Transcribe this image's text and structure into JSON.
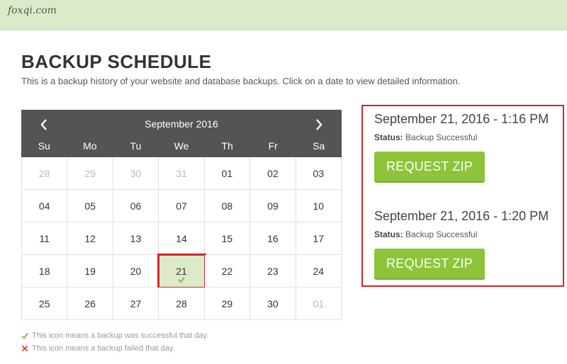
{
  "header": {
    "brand": "foxqi.com"
  },
  "page": {
    "title": "BACKUP SCHEDULE",
    "subtitle": "This is a backup history of your website and database backups. Click on a date to view detailed information."
  },
  "calendar": {
    "month_label": "September 2016",
    "weekdays": [
      "Su",
      "Mo",
      "Tu",
      "We",
      "Th",
      "Fr",
      "Sa"
    ],
    "weeks": [
      [
        {
          "d": "28",
          "muted": true
        },
        {
          "d": "29",
          "muted": true
        },
        {
          "d": "30",
          "muted": true
        },
        {
          "d": "31",
          "muted": true
        },
        {
          "d": "01"
        },
        {
          "d": "02"
        },
        {
          "d": "03"
        }
      ],
      [
        {
          "d": "04"
        },
        {
          "d": "05"
        },
        {
          "d": "06"
        },
        {
          "d": "07"
        },
        {
          "d": "08"
        },
        {
          "d": "09"
        },
        {
          "d": "10"
        }
      ],
      [
        {
          "d": "11"
        },
        {
          "d": "12"
        },
        {
          "d": "13"
        },
        {
          "d": "14"
        },
        {
          "d": "15"
        },
        {
          "d": "16"
        },
        {
          "d": "17"
        }
      ],
      [
        {
          "d": "18"
        },
        {
          "d": "19"
        },
        {
          "d": "20"
        },
        {
          "d": "21",
          "status": "success",
          "selected": true
        },
        {
          "d": "22"
        },
        {
          "d": "23"
        },
        {
          "d": "24"
        }
      ],
      [
        {
          "d": "25"
        },
        {
          "d": "26"
        },
        {
          "d": "27"
        },
        {
          "d": "28"
        },
        {
          "d": "29"
        },
        {
          "d": "30"
        },
        {
          "d": "01",
          "muted": true
        }
      ]
    ]
  },
  "legend": {
    "success": "This icon means a backup was successful that day.",
    "failed": "This icon means a backup failed that day."
  },
  "details": {
    "status_label": "Status:",
    "entries": [
      {
        "time": "September 21, 2016 - 1:16 PM",
        "status": "Backup Successful",
        "button": "REQUEST ZIP"
      },
      {
        "time": "September 21, 2016 - 1:20 PM",
        "status": "Backup Successful",
        "button": "REQUEST ZIP"
      }
    ]
  },
  "colors": {
    "accent_green": "#8dc43a",
    "backup_day_bg": "#dbebc9",
    "header_bg": "#545454",
    "highlight_red": "#d6252c",
    "failed_red": "#e0403f"
  }
}
